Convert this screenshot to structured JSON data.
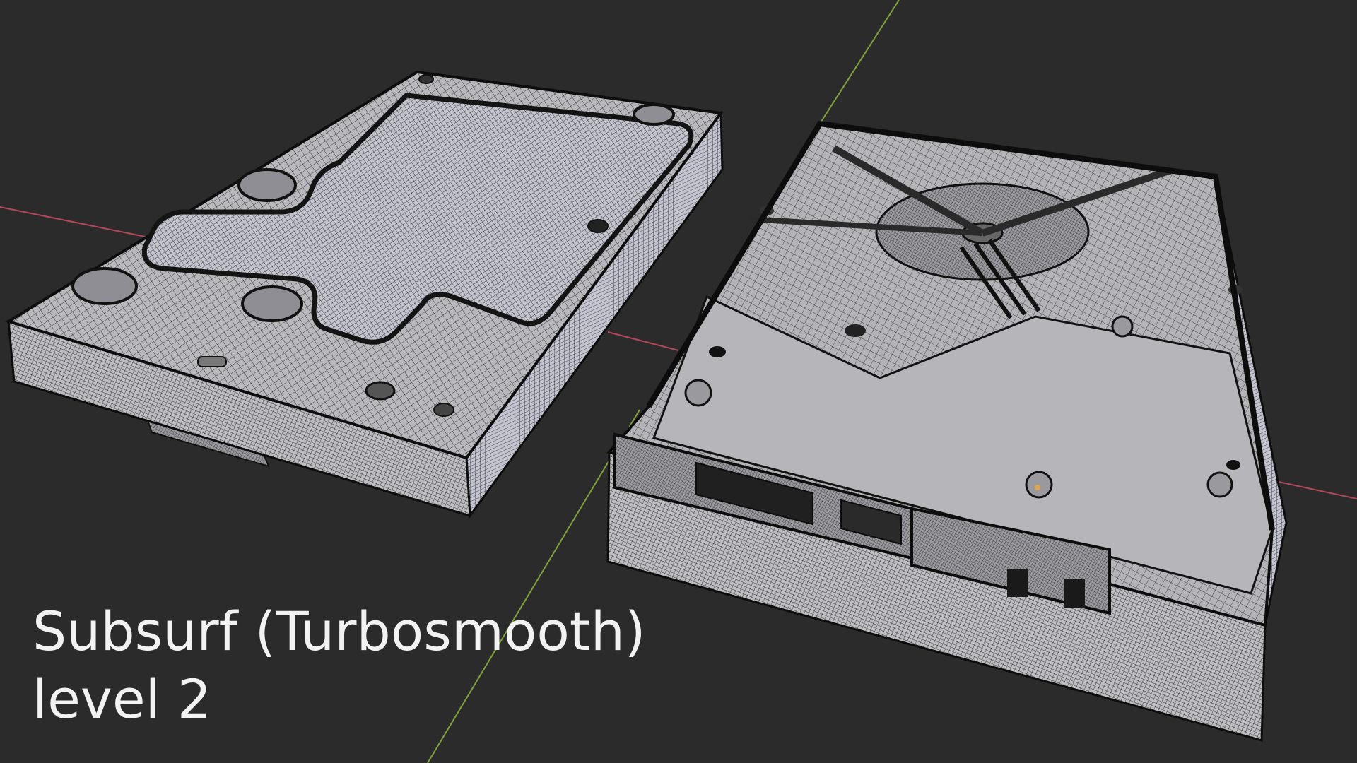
{
  "caption": {
    "line1": "Subsurf (Turbosmooth)",
    "line2": "level 2"
  },
  "viewport": {
    "background_color": "#2b2b2b",
    "x_axis_color": "#b3485a",
    "y_axis_color": "#7fa33a",
    "mesh_surface_color": "#b9b9bd",
    "mesh_side_color": "#c4c4cc",
    "wire_color": "#111111",
    "highlight_color": "#e0a64a"
  },
  "objects": [
    {
      "name": "hard-drive-top-view",
      "view": "top cover, wireframe overlay"
    },
    {
      "name": "hard-drive-bottom-view",
      "view": "underside with PCB and connectors, wireframe overlay"
    }
  ]
}
